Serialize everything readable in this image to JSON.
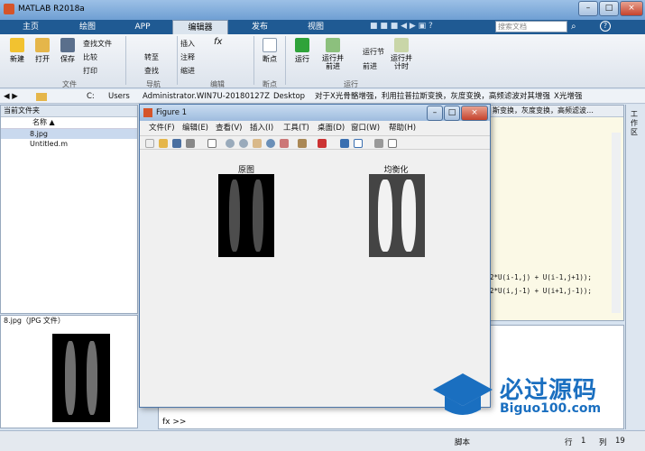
{
  "window": {
    "title": "MATLAB R2018a",
    "min": "–",
    "max": "□",
    "close": "×"
  },
  "tabs": [
    {
      "label": "主页"
    },
    {
      "label": "绘图"
    },
    {
      "label": "APP"
    },
    {
      "label": "编辑器"
    },
    {
      "label": "发布"
    },
    {
      "label": "视图"
    }
  ],
  "search": {
    "placeholder": "搜索文档"
  },
  "ribbon": {
    "new": "新建",
    "open": "打开",
    "save": "保存",
    "find_file": "查找文件",
    "compare": "比较",
    "print": "打印",
    "goto": "转至",
    "find": "查找",
    "insert": "插入",
    "comment": "注释",
    "indent": "缩进",
    "breakpoint": "断点",
    "run": "运行",
    "run_advance": "运行并\n前进",
    "run_section": "运行节",
    "advance": "前进",
    "run_time": "运行并\n计时",
    "groups": {
      "file": "文件",
      "nav": "导航",
      "edit": "编辑",
      "bp": "断点",
      "run": "运行"
    }
  },
  "address": {
    "parts": [
      "C:",
      "Users",
      "Administrator.WIN7U-20180127Z",
      "Desktop",
      "对于X光骨骼增强，利用拉普拉斯变换，灰度变换，高频滤波对其增强",
      "X光增强"
    ]
  },
  "workspace": {
    "title": "当前文件夹",
    "col": "名称 ▲",
    "files": [
      "8.jpg",
      "Untitled.m"
    ]
  },
  "details": {
    "title": "8.jpg（JPG 文件）"
  },
  "editor": {
    "tabfrag": "斯变换，灰度变换，高频滤波…",
    "code1": "2*U(i-1,j) + U(i-1,j+1));",
    "code2": "2*U(i,j-1) + U(i+1,j-1));"
  },
  "rightrail": {
    "label": "工作区"
  },
  "cmd": {
    "prompt": "fx >>"
  },
  "status": {
    "mode": "脚本",
    "row_label": "行",
    "row": "1",
    "col_label": "列",
    "col": "19"
  },
  "figure": {
    "title": "Figure 1",
    "menu": [
      "文件(F)",
      "编辑(E)",
      "查看(V)",
      "插入(I)",
      "工具(T)",
      "桌面(D)",
      "窗口(W)",
      "帮助(H)"
    ],
    "plot1_title": "原图",
    "plot2_title": "均衡化"
  },
  "watermark": {
    "brand": "必过源码",
    "url": "Biguo100.com"
  }
}
